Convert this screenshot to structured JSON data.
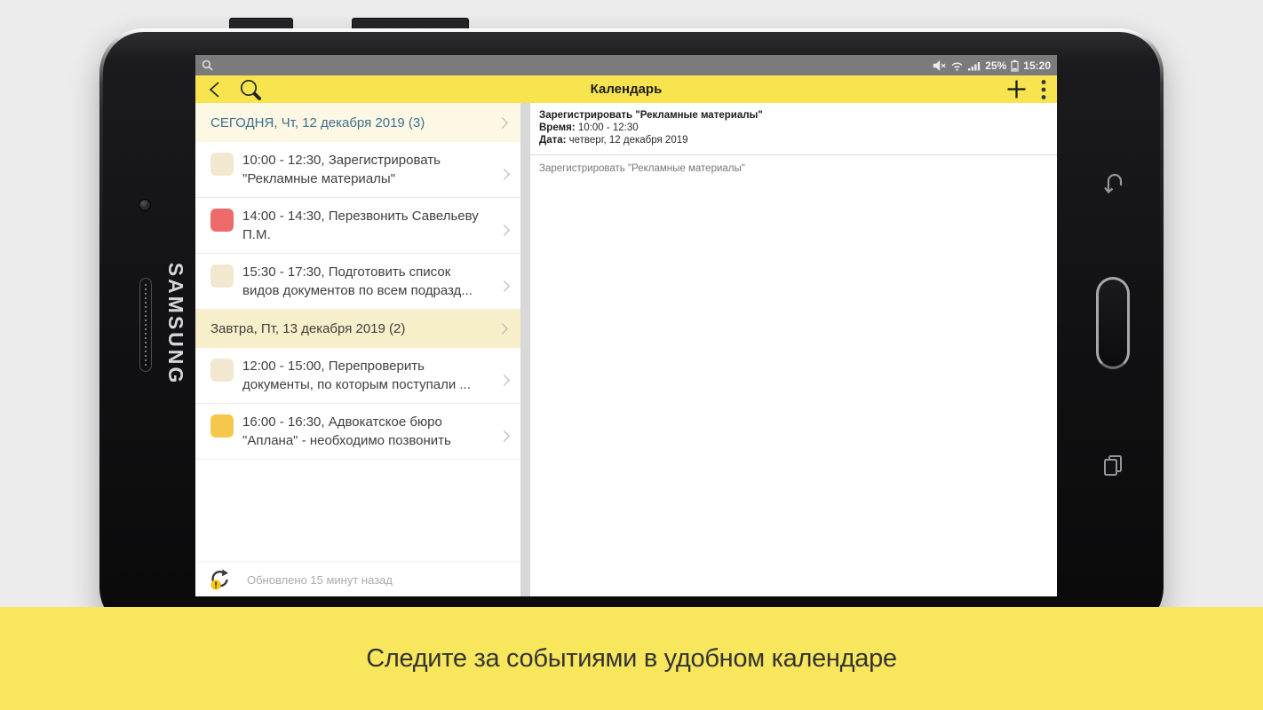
{
  "device": {
    "brand": "SAMSUNG"
  },
  "status_bar": {
    "time": "15:20",
    "battery_percent": "25%",
    "icons": [
      "search-icon",
      "mute-icon",
      "wifi-icon",
      "signal-icon",
      "battery-icon"
    ]
  },
  "header": {
    "title": "Календарь",
    "icons": [
      "back-icon",
      "search-icon",
      "add-icon",
      "menu-icon"
    ]
  },
  "list": {
    "sections": [
      {
        "label": "СЕГОДНЯ, Чт, 12 декабря 2019 (3)",
        "events": [
          {
            "text": "10:00 - 12:30, Зарегистрировать \"Рекламные материалы\"",
            "color": "#f2e8d0"
          },
          {
            "text": "14:00 - 14:30, Перезвонить Савельеву П.М.",
            "color": "#ed6b6b"
          },
          {
            "text": "15:30 - 17:30, Подготовить список видов документов по всем подразд...",
            "color": "#f2e8d0"
          }
        ]
      },
      {
        "label": "Завтра, Пт, 13 декабря 2019 (2)",
        "events": [
          {
            "text": "12:00 - 15:00, Перепроверить документы, по которым поступали ...",
            "color": "#f2e8d0"
          },
          {
            "text": "16:00 - 16:30, Адвокатское бюро \"Аплана\" - необходимо позвонить",
            "color": "#f5c84c"
          }
        ]
      }
    ],
    "footer": {
      "text": "Обновлено 15 минут назад",
      "icon": "refresh-warning-icon"
    }
  },
  "detail": {
    "title": "Зарегистрировать \"Рекламные материалы\"",
    "time_label": "Время:",
    "time_value": "10:00 - 12:30",
    "date_label": "Дата:",
    "date_value": "четверг, 12 декабря 2019",
    "description": "Зарегистрировать \"Рекламные материалы\""
  },
  "banner": {
    "text": "Следите за событиями в удобном календаре"
  },
  "colors": {
    "accent_yellow": "#f7e44e",
    "banner_yellow": "#f8e65c",
    "status_bar_bg": "#7b7b7b",
    "today_header_bg": "#fdf8e3",
    "today_header_text": "#3d6e90",
    "tomorrow_header_bg": "#f6efc9",
    "event_cream": "#f2e8d0",
    "event_red": "#ed6b6b",
    "event_yellow": "#f5c84c"
  }
}
